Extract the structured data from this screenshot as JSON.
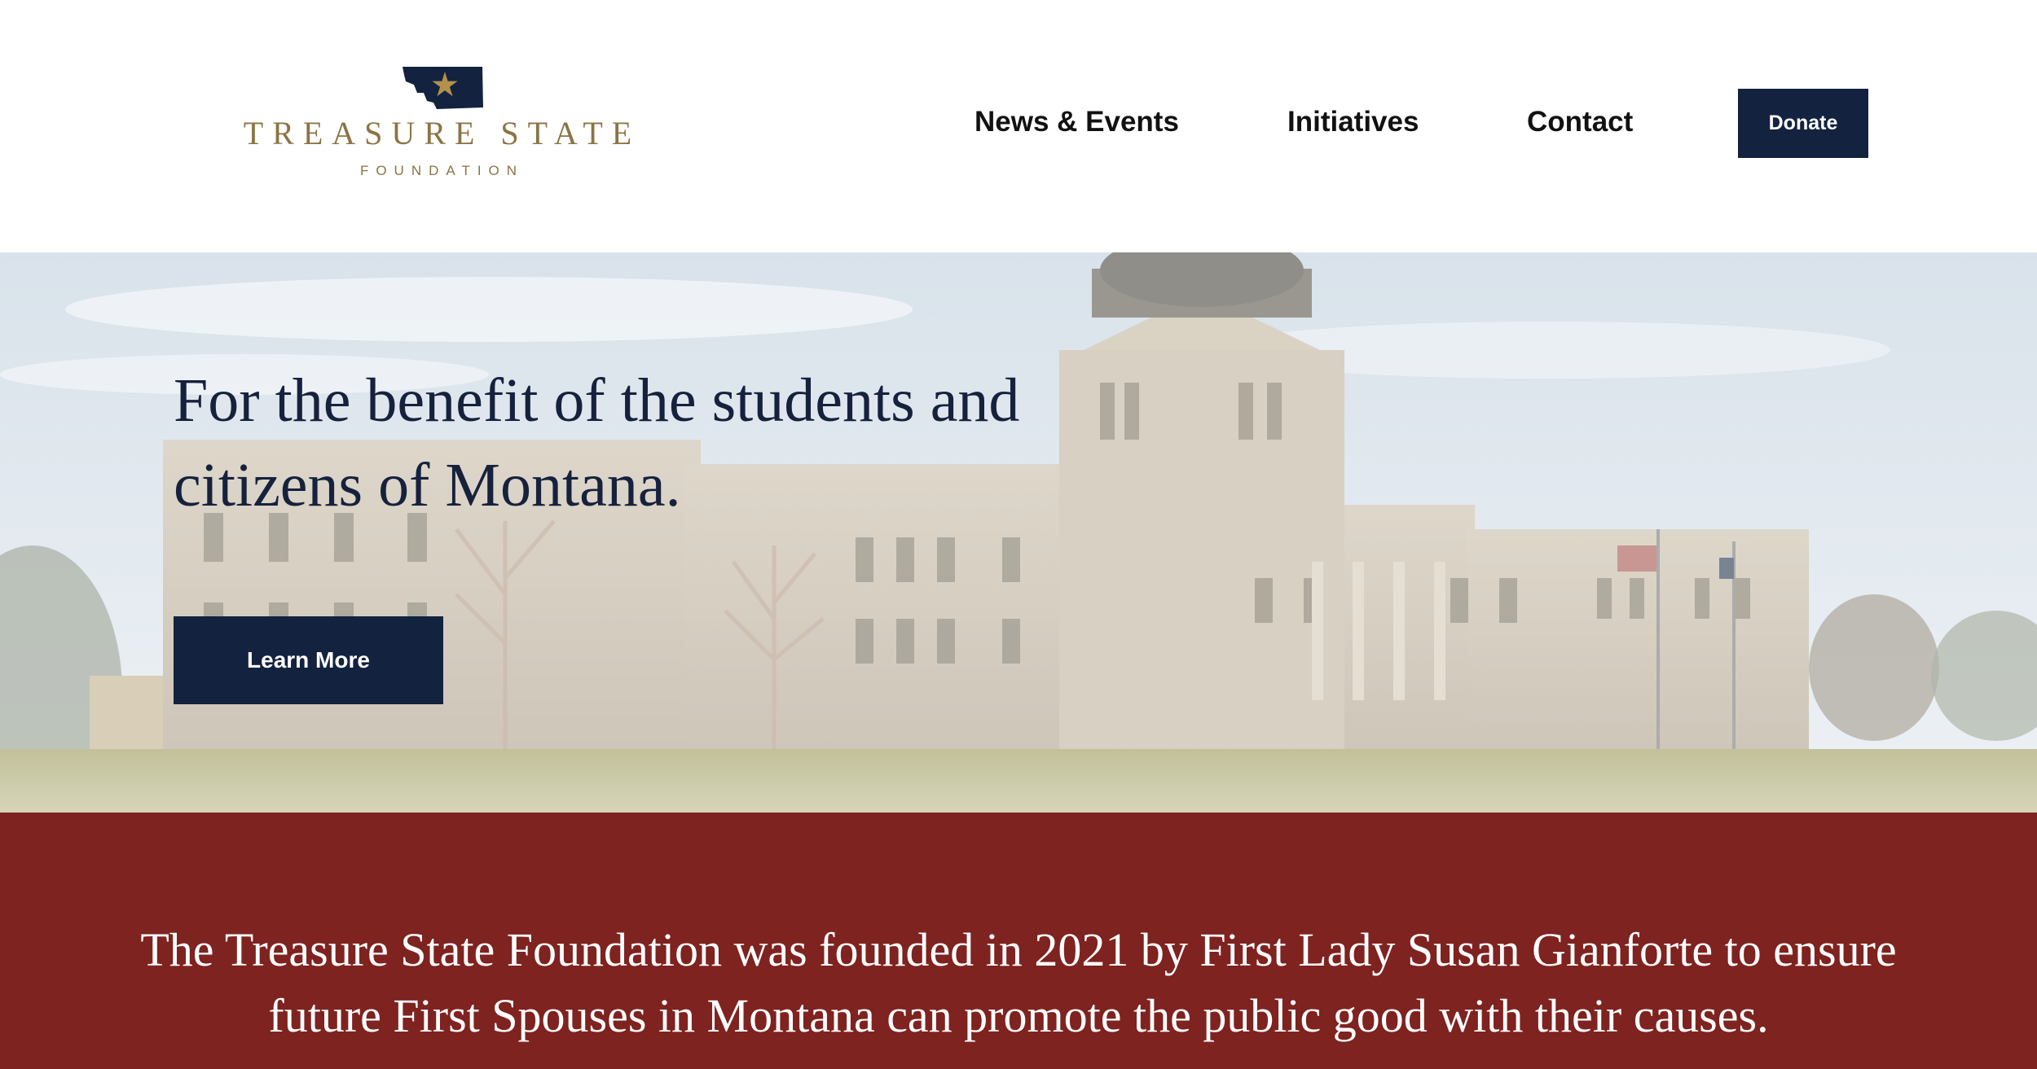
{
  "header": {
    "logo": {
      "title": "TREASURE STATE",
      "subtitle": "FOUNDATION",
      "icon": "montana-star-icon",
      "colors": {
        "mark": "#13223f",
        "star": "#b4914a",
        "text": "#8a7444"
      }
    },
    "nav": [
      {
        "label": "News & Events"
      },
      {
        "label": "Initiatives"
      },
      {
        "label": "Contact"
      }
    ],
    "donate_label": "Donate"
  },
  "hero": {
    "heading": "For the benefit of the students and citizens of Montana.",
    "button_label": "Learn More",
    "background": "state-capitol-building-image"
  },
  "mission": {
    "text": "The Treasure State Foundation was founded in 2021 by First Lady Susan Gianforte to ensure future First Spouses in Montana can promote the public good with their causes."
  },
  "colors": {
    "navy": "#13223f",
    "maroon": "#7e2320",
    "gold": "#8a7444",
    "white": "#ffffff"
  }
}
